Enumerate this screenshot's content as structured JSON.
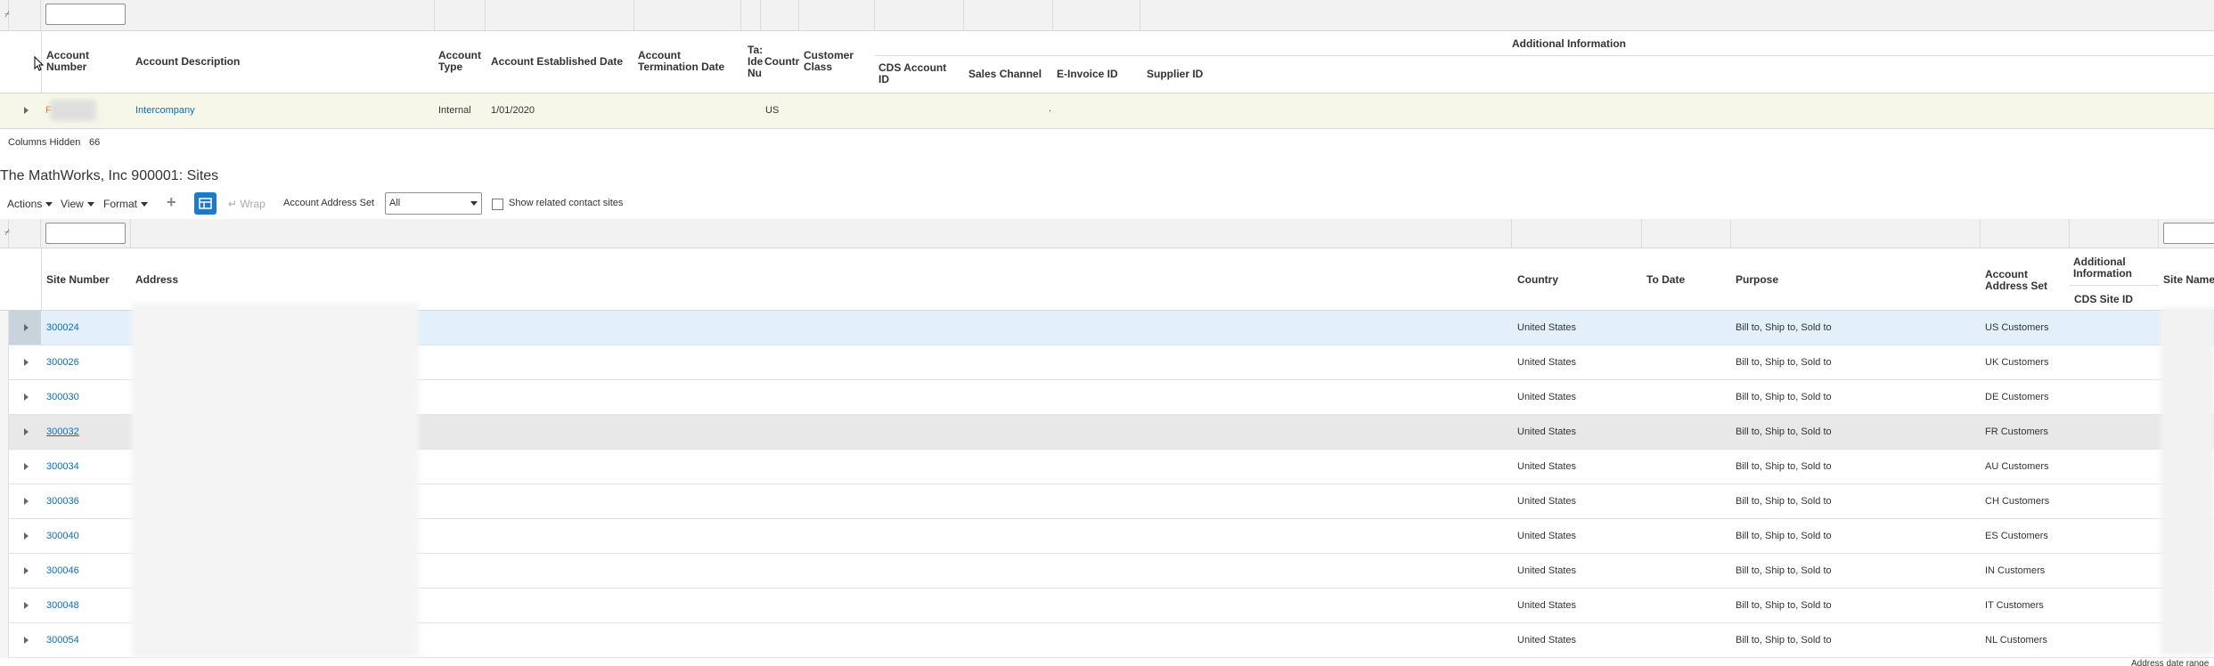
{
  "accounts_table": {
    "headers": {
      "account_number": "Account Number",
      "account_description": "Account Description",
      "account_type": "Account Type",
      "account_established_date": "Account Established Date",
      "account_termination_date": "Account Termination Date",
      "tax_id": "Ta: Ide Nu",
      "country": "Countr",
      "customer_class": "Customer Class",
      "additional_information": "Additional Information",
      "cds_account_id": "CDS Account ID",
      "sales_channel": "Sales Channel",
      "e_invoice_id": "E-Invoice ID",
      "supplier_id": "Supplier ID"
    },
    "row": {
      "account_number_visible": "F",
      "account_description": "Intercompany",
      "account_type": "Internal",
      "established_date": "1/01/2020",
      "country": "US",
      "e_invoice_id": "."
    },
    "columns_hidden_label": "Columns Hidden",
    "columns_hidden_count": "66"
  },
  "sites_section": {
    "title": "The MathWorks, Inc 900001: Sites",
    "toolbar": {
      "actions": "Actions",
      "view": "View",
      "format": "Format",
      "wrap": "Wrap",
      "account_address_set_label": "Account Address Set",
      "account_address_set_value": "All",
      "show_related_label": "Show related contact sites"
    },
    "headers": {
      "site_number": "Site Number",
      "address": "Address",
      "country": "Country",
      "to_date": "To Date",
      "purpose": "Purpose",
      "account_address_set": "Account Address Set",
      "additional_information": "Additional Information",
      "cds_site_id": "CDS Site ID",
      "site_name": "Site Name"
    },
    "rows": [
      {
        "site_number": "300024",
        "country": "United States",
        "purpose": "Bill to, Ship to, Sold to",
        "address_set": "US Customers"
      },
      {
        "site_number": "300026",
        "country": "United States",
        "purpose": "Bill to, Ship to, Sold to",
        "address_set": "UK Customers"
      },
      {
        "site_number": "300030",
        "country": "United States",
        "purpose": "Bill to, Ship to, Sold to",
        "address_set": "DE Customers"
      },
      {
        "site_number": "300032",
        "country": "United States",
        "purpose": "Bill to, Ship to, Sold to",
        "address_set": "FR Customers"
      },
      {
        "site_number": "300034",
        "country": "United States",
        "purpose": "Bill to, Ship to, Sold to",
        "address_set": "AU Customers"
      },
      {
        "site_number": "300036",
        "country": "United States",
        "purpose": "Bill to, Ship to, Sold to",
        "address_set": "CH Customers"
      },
      {
        "site_number": "300040",
        "country": "United States",
        "purpose": "Bill to, Ship to, Sold to",
        "address_set": "ES Customers"
      },
      {
        "site_number": "300046",
        "country": "United States",
        "purpose": "Bill to, Ship to, Sold to",
        "address_set": "IN Customers"
      },
      {
        "site_number": "300048",
        "country": "United States",
        "purpose": "Bill to, Ship to, Sold to",
        "address_set": "IT Customers"
      },
      {
        "site_number": "300054",
        "country": "United States",
        "purpose": "Bill to, Ship to, Sold to",
        "address_set": "NL Customers"
      }
    ],
    "footer_partial": "Address date range"
  },
  "colors": {
    "link": "#0a6ebd",
    "selected_row": "#e3f0fb",
    "hover_row": "#e8e8e8",
    "account_row": "#f7f7e9",
    "icon_button_blue": "#1f79c4"
  }
}
